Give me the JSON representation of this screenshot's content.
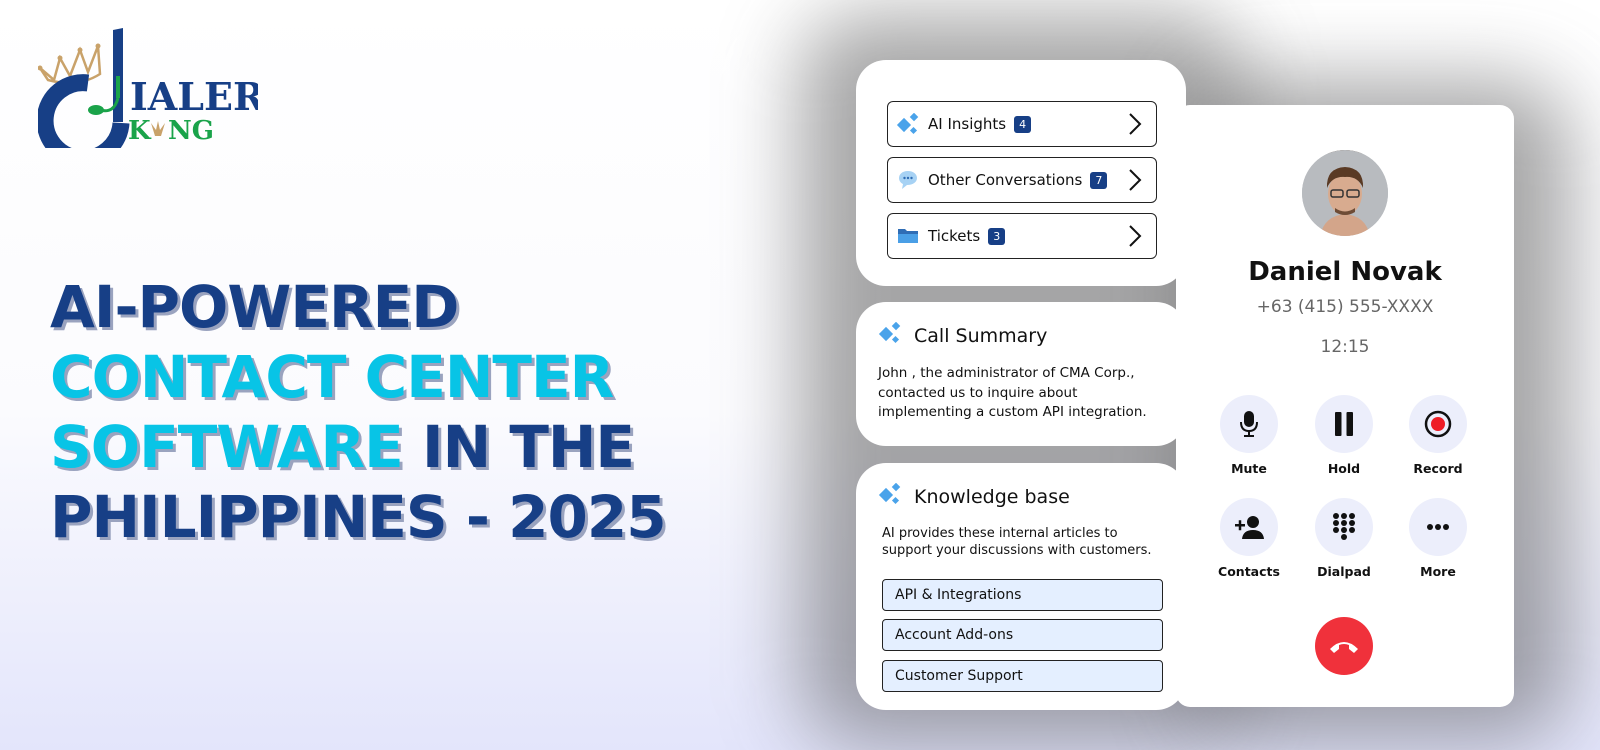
{
  "brand": {
    "logo_line1": "IALER",
    "logo_line2": "KING",
    "colors": {
      "blue": "#173f86",
      "green": "#1aa34a",
      "gold": "#c9a26a"
    }
  },
  "headline": {
    "line1": "AI-POWERED",
    "line2": "CONTACT CENTER",
    "line3_highlight": "SOFTWARE",
    "line3_rest": " IN THE",
    "line4": "PHILIPPINES - 2025",
    "colors": {
      "dark": "#173f86",
      "highlight": "#08c4e6"
    }
  },
  "panel_menu": {
    "items": [
      {
        "label": "AI Insights",
        "count": "4",
        "icon": "ai-sparkle-icon"
      },
      {
        "label": "Other Conversations",
        "count": "7",
        "icon": "chat-bubble-icon"
      },
      {
        "label": "Tickets",
        "count": "3",
        "icon": "folder-icon"
      }
    ]
  },
  "call_summary": {
    "title": "Call Summary",
    "text": "John , the administrator of CMA Corp., contacted us to inquire about implementing a custom API integration."
  },
  "knowledge_base": {
    "title": "Knowledge base",
    "description": "AI provides these internal articles to support your discussions with customers.",
    "articles": [
      "API & Integrations",
      "Account Add-ons",
      "Customer Support"
    ]
  },
  "call": {
    "caller_name": "Daniel Novak",
    "phone_number": "+63 (415) 555-XXXX",
    "duration": "12:15",
    "controls": [
      {
        "label": "Mute",
        "icon": "microphone-icon"
      },
      {
        "label": "Hold",
        "icon": "pause-icon"
      },
      {
        "label": "Record",
        "icon": "record-icon"
      },
      {
        "label": "Contacts",
        "icon": "add-contact-icon"
      },
      {
        "label": "Dialpad",
        "icon": "dialpad-icon"
      },
      {
        "label": "More",
        "icon": "more-icon"
      }
    ],
    "end_call_color": "#f0313b"
  }
}
